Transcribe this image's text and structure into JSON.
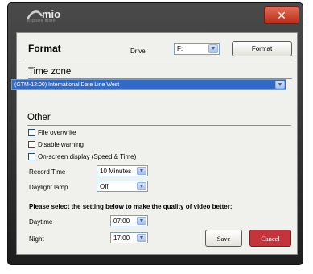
{
  "window": {
    "logo_text": "mio",
    "logo_subtitle": "explore more",
    "close_label": "✕"
  },
  "format": {
    "title": "Format",
    "drive_label": "Drive",
    "drive_value": "F:",
    "button_label": "Format"
  },
  "timezone": {
    "title": "Time zone",
    "value": "(GTM-12:00) International Date Line West"
  },
  "other": {
    "title": "Other",
    "checkboxes": [
      {
        "label": "File overwrite",
        "checked": false
      },
      {
        "label": "Disable warning",
        "checked": false
      },
      {
        "label": "On-screen display (Speed & Time)",
        "checked": false
      }
    ],
    "record_time_label": "Record Time",
    "record_time_value": "10 Minutes",
    "daylight_lamp_label": "Daylight lamp",
    "daylight_lamp_value": "Off",
    "quality_note": "Please select the setting below to make the quality of video better:",
    "daytime_label": "Daytime",
    "daytime_value": "07:00",
    "night_label": "Night",
    "night_value": "17:00"
  },
  "actions": {
    "save_label": "Save",
    "cancel_label": "Cancel"
  },
  "colors": {
    "window_frame": "#2e2e2e",
    "close_button": "#c8412a",
    "cancel_button": "#c4343a",
    "selection_blue": "#3169c6",
    "panel_bg": "#f0f0ec"
  }
}
